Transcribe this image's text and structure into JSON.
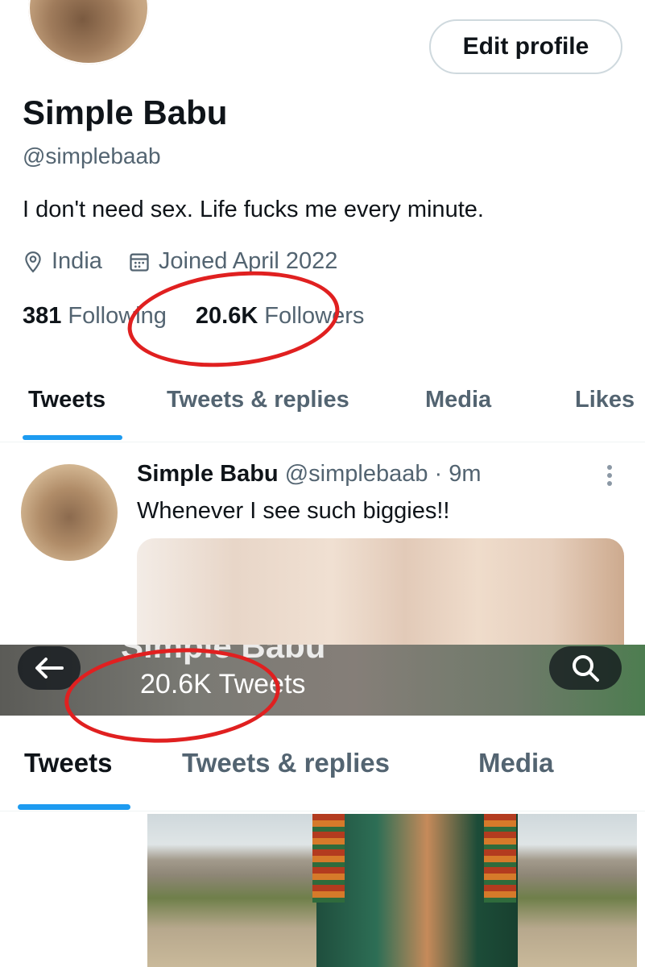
{
  "profile": {
    "edit_button": "Edit profile",
    "name": "Simple Babu",
    "handle": "@simplebaab",
    "bio": "I don't need sex. Life fucks me every minute.",
    "location": "India",
    "joined": "Joined April 2022",
    "following_count": "381",
    "following_label": "Following",
    "followers_count": "20.6K",
    "followers_label": "Followers"
  },
  "tabs_top": [
    {
      "label": "Tweets"
    },
    {
      "label": "Tweets & replies"
    },
    {
      "label": "Media"
    },
    {
      "label": "Likes"
    }
  ],
  "tweet": {
    "author": "Simple Babu",
    "handle_time": "@simplebaab · 9m",
    "text": "Whenever I see such biggies!!"
  },
  "header2": {
    "name": "Simple Babu",
    "tweets_count": "20.6K Tweets"
  },
  "tabs_bottom": [
    {
      "label": "Tweets"
    },
    {
      "label": "Tweets & replies"
    },
    {
      "label": "Media"
    }
  ],
  "colors": {
    "accent": "#1d9bf0",
    "highlight_circle": "#e02020",
    "secondary_text": "#536471"
  }
}
